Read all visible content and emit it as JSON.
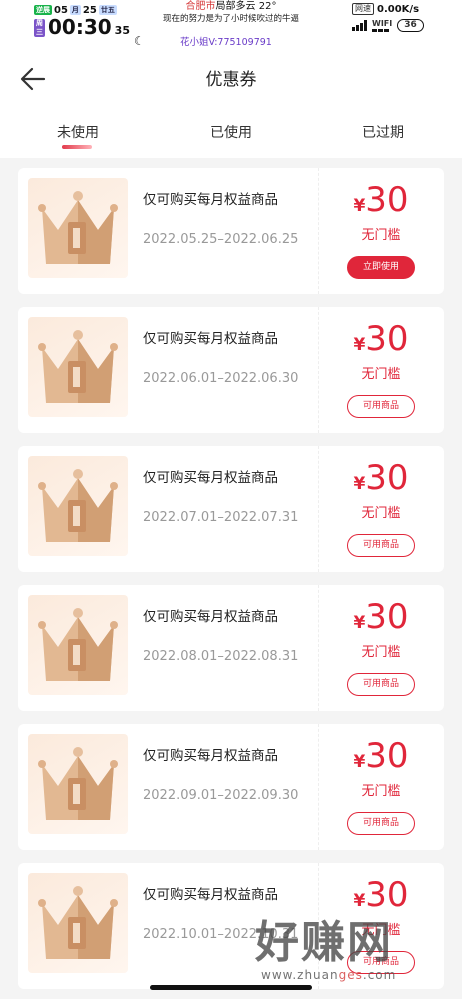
{
  "status_bar": {
    "tag_left": "逆展",
    "date_month": "05",
    "date_month_tag": "月",
    "date_day": "25",
    "lunar": "廿五",
    "weekday": "周三",
    "clock": "00:30",
    "seconds": "35",
    "weather_city": "合肥市",
    "weather_text": "局部多云 22°",
    "motto": "现在的努力是为了小时候吹过的牛逼",
    "wechat": "花小姐V:775109791",
    "net_label": "网速",
    "net_speed": "0.00K/s",
    "wifi_label": "WIFI",
    "battery": "36"
  },
  "header": {
    "title": "优惠券",
    "back_icon": "arrow-left-icon"
  },
  "tabs": [
    {
      "label": "未使用",
      "active": true
    },
    {
      "label": "已使用",
      "active": false
    },
    {
      "label": "已过期",
      "active": false
    }
  ],
  "coupons": [
    {
      "title": "仅可购买每月权益商品",
      "date": "2022.05.25–2022.06.25",
      "currency": "¥",
      "amount": "30",
      "threshold": "无门槛",
      "button": "立即使用",
      "button_style": "solid"
    },
    {
      "title": "仅可购买每月权益商品",
      "date": "2022.06.01–2022.06.30",
      "currency": "¥",
      "amount": "30",
      "threshold": "无门槛",
      "button": "可用商品",
      "button_style": "outline"
    },
    {
      "title": "仅可购买每月权益商品",
      "date": "2022.07.01–2022.07.31",
      "currency": "¥",
      "amount": "30",
      "threshold": "无门槛",
      "button": "可用商品",
      "button_style": "outline"
    },
    {
      "title": "仅可购买每月权益商品",
      "date": "2022.08.01–2022.08.31",
      "currency": "¥",
      "amount": "30",
      "threshold": "无门槛",
      "button": "可用商品",
      "button_style": "outline"
    },
    {
      "title": "仅可购买每月权益商品",
      "date": "2022.09.01–2022.09.30",
      "currency": "¥",
      "amount": "30",
      "threshold": "无门槛",
      "button": "可用商品",
      "button_style": "outline"
    },
    {
      "title": "仅可购买每月权益商品",
      "date": "2022.10.01–2022.10.31",
      "currency": "¥",
      "amount": "30",
      "threshold": "无门槛",
      "button": "可用商品",
      "button_style": "outline"
    }
  ],
  "watermark": {
    "main": "好赚网",
    "sub_prefix": "www.zhuan",
    "sub_highlight": "ges",
    "sub_suffix": ".com"
  },
  "colors": {
    "accent": "#e0263a",
    "background": "#f4f4f4"
  }
}
